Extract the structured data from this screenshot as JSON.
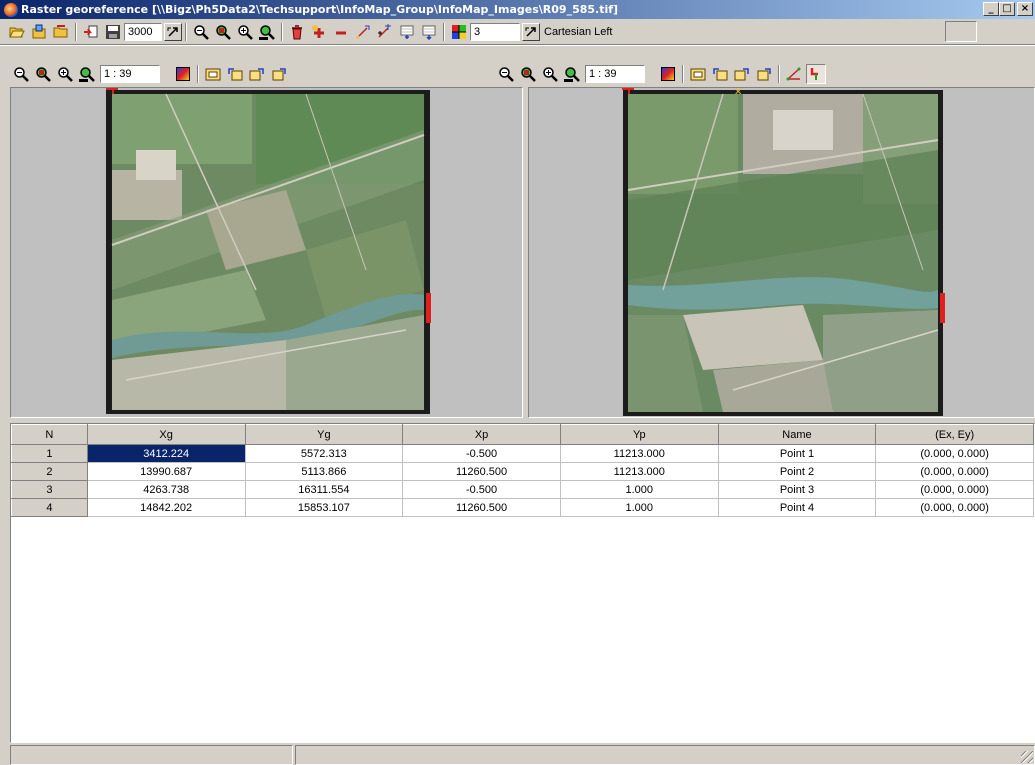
{
  "window": {
    "title": "Raster georeference [\\\\Bigz\\Ph5Data2\\Techsupport\\InfoMap_Group\\InfoMap_Images\\R09_585.tif]",
    "min_label": "_",
    "max_label": "□",
    "close_label": "×"
  },
  "toolbar_main": {
    "scale_value": "3000",
    "points_count_value": "3",
    "coord_system_label": "Cartesian Left"
  },
  "left_view": {
    "zoom_ratio": "1 : 39"
  },
  "right_view": {
    "zoom_ratio": "1 : 39"
  },
  "grid": {
    "columns": [
      "N",
      "Xg",
      "Yg",
      "Xp",
      "Yp",
      "Name",
      "(Ex, Ey)"
    ],
    "rows": [
      {
        "n": "1",
        "xg": "3412.224",
        "yg": "5572.313",
        "xp": "-0.500",
        "yp": "11213.000",
        "name": "Point 1",
        "err": "(0.000, 0.000)"
      },
      {
        "n": "2",
        "xg": "13990.687",
        "yg": "5113.866",
        "xp": "11260.500",
        "yp": "11213.000",
        "name": "Point 2",
        "err": "(0.000, 0.000)"
      },
      {
        "n": "3",
        "xg": "4263.738",
        "yg": "16311.554",
        "xp": "-0.500",
        "yp": "1.000",
        "name": "Point 3",
        "err": "(0.000, 0.000)"
      },
      {
        "n": "4",
        "xg": "14842.202",
        "yg": "15853.107",
        "xp": "11260.500",
        "yp": "1.000",
        "name": "Point 4",
        "err": "(0.000, 0.000)"
      }
    ],
    "selected_cell": "row 1, Xg"
  },
  "colors": {
    "title_gradient_start": "#0a246a",
    "title_gradient_end": "#a6caf0",
    "selection": "#0a246a",
    "face": "#d4d0c8",
    "marker_red": "#e02020"
  },
  "icons": {
    "toolbar_main": [
      "open-folder-icon",
      "open-project-icon",
      "open-raster-icon",
      "export-icon",
      "save-icon",
      "zoom-out-icon",
      "zoom-in-icon",
      "zoom-plus-icon",
      "zoom-window-icon",
      "delete-points-icon",
      "add-point-icon",
      "remove-point-icon",
      "move-point-icon",
      "add-points-icon",
      "transform-forward-icon",
      "transform-back-icon",
      "color-grid-icon"
    ],
    "view_toolbar": [
      "zoom-out-icon",
      "zoom-in-icon",
      "zoom-plus-icon",
      "zoom-window-icon",
      "color-palette-icon",
      "fit-image-icon",
      "rotate-left-icon",
      "rotate-right-icon",
      "flip-icon"
    ],
    "right_extra": [
      "triangle-points-icon",
      "crosshair-marker-icon"
    ]
  }
}
